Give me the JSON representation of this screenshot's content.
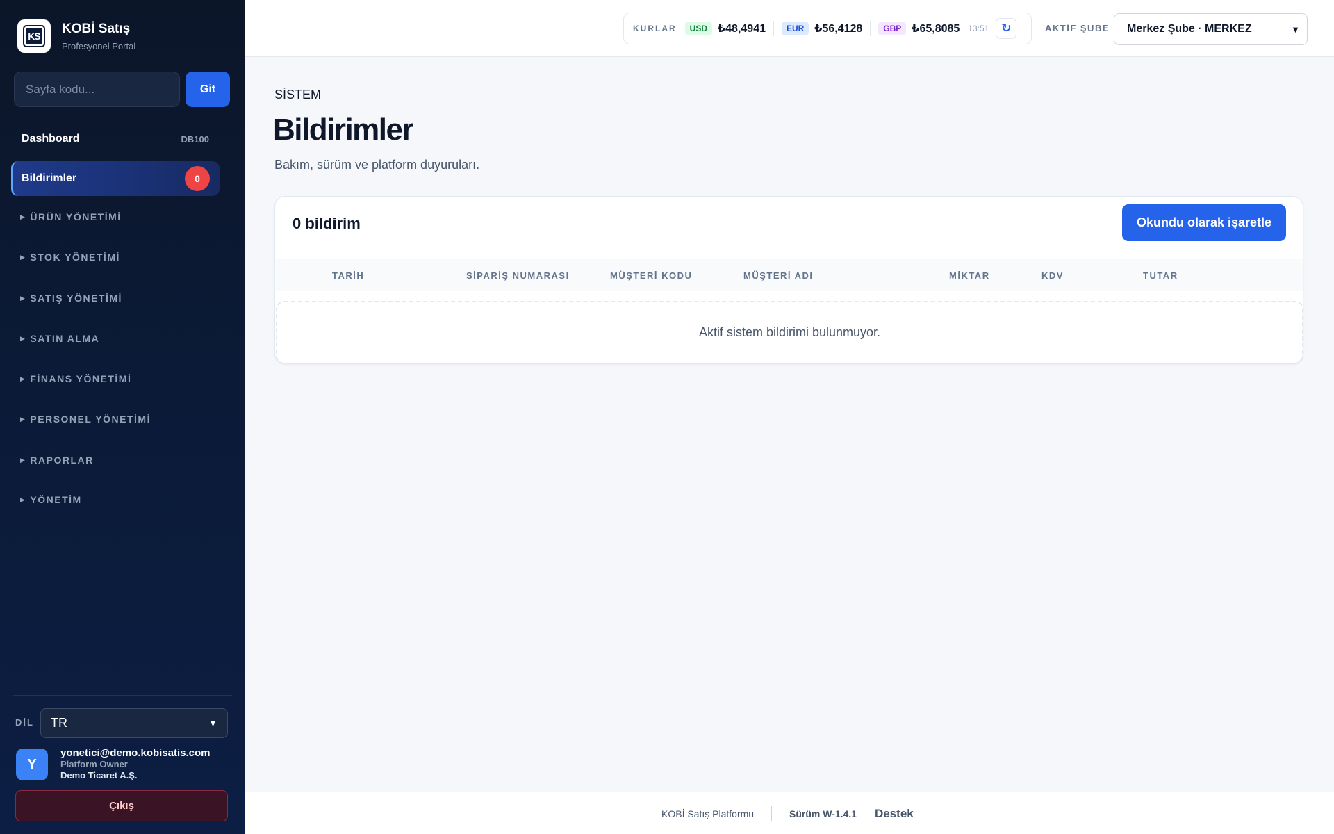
{
  "brand": {
    "title": "KOBİ Satış",
    "subtitle": "Profesyonel Portal",
    "logo_text": "KS"
  },
  "page_search": {
    "placeholder": "Sayfa kodu...",
    "button": "Git"
  },
  "sidebar": {
    "dashboard": {
      "label": "Dashboard",
      "code": "DB100"
    },
    "active": {
      "label": "Bildirimler",
      "badge": "0"
    },
    "groups": [
      "ÜRÜN YÖNETİMİ",
      "STOK YÖNETİMİ",
      "SATIŞ YÖNETİMİ",
      "SATIN ALMA",
      "FİNANS YÖNETİMİ",
      "PERSONEL YÖNETİMİ",
      "RAPORLAR",
      "YÖNETİM"
    ],
    "language_label": "DİL",
    "language_value": "TR",
    "user": {
      "initial": "Y",
      "email": "yonetici@demo.kobisatis.com",
      "role": "Platform Owner",
      "company": "Demo Ticaret A.Ş."
    },
    "logout": "Çıkış"
  },
  "topbar": {
    "rates_title": "KURLAR",
    "rates": [
      {
        "code": "USD",
        "value": "₺48,4941"
      },
      {
        "code": "EUR",
        "value": "₺56,4128"
      },
      {
        "code": "GBP",
        "value": "₺65,8085"
      }
    ],
    "time": "13:51",
    "branch_label": "AKTİF ŞUBE",
    "branch_value": "Merkez Şube · MERKEZ"
  },
  "main": {
    "section": "SİSTEM",
    "title": "Bildirimler",
    "description": "Bakım, sürüm ve platform duyuruları.",
    "count": "0 bildirim",
    "mark_read": "Okundu olarak işaretle",
    "columns": [
      "TARİH",
      "SİPARİŞ NUMARASI",
      "MÜŞTERİ KODU",
      "MÜŞTERİ ADI",
      "MİKTAR",
      "KDV",
      "TUTAR"
    ],
    "empty": "Aktif sistem bildirimi bulunmuyor."
  },
  "footer": {
    "platform": "KOBİ Satış Platformu",
    "version": "Sürüm W-1.4.1",
    "support": "Destek"
  },
  "colors": {
    "accent": "#2563eb",
    "sidebar_bg": "#0b1a36",
    "badge": "#ef4444"
  }
}
